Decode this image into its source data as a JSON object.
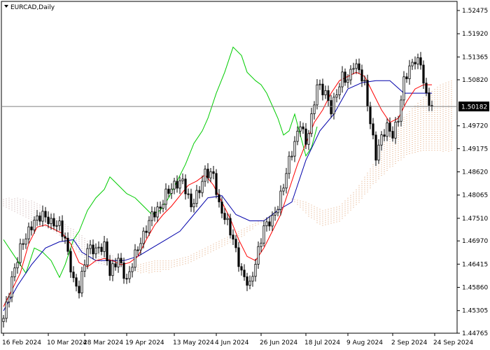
{
  "chart_data": {
    "type": "candlestick",
    "title": "EURCAD,Daily",
    "symbol": "EURCAD",
    "timeframe": "Daily",
    "current_price": 1.50182,
    "current_price_label": "1.50182",
    "y_range": [
      1.44765,
      1.52475
    ],
    "y_ticks": [
      "1.52475",
      "1.51920",
      "1.51365",
      "1.50820",
      "1.50182",
      "1.49720",
      "1.49175",
      "1.48620",
      "1.48065",
      "1.47510",
      "1.46970",
      "1.46415",
      "1.45860",
      "1.45305",
      "1.44765"
    ],
    "x_tick_labels": [
      "16 Feb 2024",
      "10 Mar 2024",
      "28 Mar 2024",
      "19 Apr 2024",
      "13 May 2024",
      "4 Jun 2024",
      "26 Jun 2024",
      "18 Jul 2024",
      "9 Aug 2024",
      "2 Sep 2024",
      "24 Sep 2024"
    ],
    "x_tick_index": [
      0,
      16,
      29,
      44,
      61,
      76,
      92,
      108,
      123,
      139,
      154
    ],
    "grid": false,
    "colors": {
      "candle": "#000000",
      "tenkan": "#ff0000",
      "kijun": "#0000aa",
      "chikou": "#00cc00",
      "kumo_bull": "#e0a070",
      "kumo_bear": "#c0a0a0",
      "price_line": "#808080"
    },
    "series": [
      {
        "id": "close",
        "anchors": [
          [
            0,
            1.4512
          ],
          [
            3,
            1.4605
          ],
          [
            6,
            1.468
          ],
          [
            9,
            1.472
          ],
          [
            11,
            1.4745
          ],
          [
            14,
            1.476
          ],
          [
            17,
            1.474
          ],
          [
            20,
            1.4735
          ],
          [
            22,
            1.47
          ],
          [
            25,
            1.46
          ],
          [
            27,
            1.458
          ],
          [
            30,
            1.468
          ],
          [
            33,
            1.4675
          ],
          [
            36,
            1.4685
          ],
          [
            38,
            1.462
          ],
          [
            41,
            1.4655
          ],
          [
            44,
            1.46
          ],
          [
            47,
            1.4665
          ],
          [
            50,
            1.471
          ],
          [
            53,
            1.476
          ],
          [
            56,
            1.4775
          ],
          [
            58,
            1.481
          ],
          [
            61,
            1.483
          ],
          [
            64,
            1.484
          ],
          [
            67,
            1.478
          ],
          [
            70,
            1.482
          ],
          [
            72,
            1.486
          ],
          [
            75,
            1.4855
          ],
          [
            77,
            1.478
          ],
          [
            80,
            1.474
          ],
          [
            82,
            1.47
          ],
          [
            85,
            1.462
          ],
          [
            88,
            1.459
          ],
          [
            90,
            1.4645
          ],
          [
            93,
            1.473
          ],
          [
            96,
            1.475
          ],
          [
            98,
            1.478
          ],
          [
            100,
            1.483
          ],
          [
            102,
            1.489
          ],
          [
            104,
            1.493
          ],
          [
            106,
            1.498
          ],
          [
            108,
            1.493
          ],
          [
            110,
            1.499
          ],
          [
            112,
            1.507
          ],
          [
            115,
            1.505
          ],
          [
            117,
            1.501
          ],
          [
            119,
            1.505
          ],
          [
            121,
            1.509
          ],
          [
            123,
            1.508
          ],
          [
            125,
            1.512
          ],
          [
            127,
            1.5105
          ],
          [
            129,
            1.507
          ],
          [
            131,
            1.498
          ],
          [
            133,
            1.49
          ],
          [
            135,
            1.4945
          ],
          [
            137,
            1.497
          ],
          [
            139,
            1.495
          ],
          [
            141,
            1.499
          ],
          [
            143,
            1.508
          ],
          [
            145,
            1.511
          ],
          [
            147,
            1.513
          ],
          [
            149,
            1.512
          ],
          [
            151,
            1.504
          ],
          [
            153,
            1.5018
          ]
        ]
      },
      {
        "id": "tenkan",
        "anchors": [
          [
            0,
            1.454
          ],
          [
            3,
            1.458
          ],
          [
            6,
            1.462
          ],
          [
            9,
            1.469
          ],
          [
            12,
            1.473
          ],
          [
            15,
            1.4735
          ],
          [
            18,
            1.4725
          ],
          [
            21,
            1.4715
          ],
          [
            24,
            1.469
          ],
          [
            27,
            1.4645
          ],
          [
            30,
            1.4635
          ],
          [
            33,
            1.465
          ],
          [
            36,
            1.4655
          ],
          [
            39,
            1.465
          ],
          [
            42,
            1.464
          ],
          [
            45,
            1.4645
          ],
          [
            48,
            1.466
          ],
          [
            51,
            1.47
          ],
          [
            54,
            1.4735
          ],
          [
            57,
            1.476
          ],
          [
            60,
            1.478
          ],
          [
            63,
            1.4805
          ],
          [
            66,
            1.483
          ],
          [
            69,
            1.484
          ],
          [
            72,
            1.4855
          ],
          [
            75,
            1.483
          ],
          [
            78,
            1.479
          ],
          [
            81,
            1.475
          ],
          [
            84,
            1.47
          ],
          [
            87,
            1.466
          ],
          [
            90,
            1.465
          ],
          [
            93,
            1.468
          ],
          [
            96,
            1.472
          ],
          [
            99,
            1.476
          ],
          [
            102,
            1.482
          ],
          [
            105,
            1.488
          ],
          [
            108,
            1.493
          ],
          [
            111,
            1.498
          ],
          [
            114,
            1.501
          ],
          [
            117,
            1.505
          ],
          [
            120,
            1.508
          ],
          [
            123,
            1.509
          ],
          [
            126,
            1.51
          ],
          [
            129,
            1.509
          ],
          [
            132,
            1.505
          ],
          [
            135,
            1.501
          ],
          [
            138,
            1.498
          ],
          [
            141,
            1.499
          ],
          [
            144,
            1.503
          ],
          [
            147,
            1.506
          ],
          [
            150,
            1.507
          ],
          [
            153,
            1.507
          ]
        ]
      },
      {
        "id": "kijun",
        "anchors": [
          [
            0,
            1.453
          ],
          [
            5,
            1.459
          ],
          [
            10,
            1.464
          ],
          [
            15,
            1.468
          ],
          [
            20,
            1.4695
          ],
          [
            25,
            1.47
          ],
          [
            28,
            1.467
          ],
          [
            33,
            1.465
          ],
          [
            38,
            1.465
          ],
          [
            43,
            1.465
          ],
          [
            48,
            1.466
          ],
          [
            53,
            1.468
          ],
          [
            58,
            1.47
          ],
          [
            63,
            1.472
          ],
          [
            68,
            1.476
          ],
          [
            73,
            1.48
          ],
          [
            78,
            1.4805
          ],
          [
            83,
            1.476
          ],
          [
            88,
            1.4745
          ],
          [
            93,
            1.4745
          ],
          [
            98,
            1.477
          ],
          [
            103,
            1.479
          ],
          [
            108,
            1.489
          ],
          [
            113,
            1.496
          ],
          [
            118,
            1.5
          ],
          [
            123,
            1.506
          ],
          [
            128,
            1.5075
          ],
          [
            133,
            1.508
          ],
          [
            138,
            1.508
          ],
          [
            143,
            1.505
          ],
          [
            148,
            1.505
          ],
          [
            153,
            1.505
          ]
        ]
      },
      {
        "id": "chikou",
        "anchors": [
          [
            0,
            1.47
          ],
          [
            4,
            1.466
          ],
          [
            8,
            1.462
          ],
          [
            11,
            1.468
          ],
          [
            14,
            1.467
          ],
          [
            17,
            1.465
          ],
          [
            20,
            1.461
          ],
          [
            22,
            1.464
          ],
          [
            25,
            1.47
          ],
          [
            27,
            1.472
          ],
          [
            30,
            1.477
          ],
          [
            33,
            1.48
          ],
          [
            36,
            1.482
          ],
          [
            38,
            1.485
          ],
          [
            41,
            1.483
          ],
          [
            44,
            1.481
          ],
          [
            47,
            1.48
          ],
          [
            50,
            1.478
          ],
          [
            53,
            1.476
          ],
          [
            56,
            1.477
          ],
          [
            59,
            1.48
          ],
          [
            62,
            1.484
          ],
          [
            65,
            1.488
          ],
          [
            68,
            1.493
          ],
          [
            71,
            1.496
          ],
          [
            73,
            1.499
          ],
          [
            76,
            1.505
          ],
          [
            79,
            1.51
          ],
          [
            82,
            1.516
          ],
          [
            85,
            1.514
          ],
          [
            87,
            1.51
          ],
          [
            90,
            1.508
          ],
          [
            92,
            1.507
          ],
          [
            94,
            1.505
          ],
          [
            96,
            1.502
          ],
          [
            98,
            1.499
          ],
          [
            100,
            1.495
          ],
          [
            102,
            1.496
          ],
          [
            104,
            1.5
          ],
          [
            106,
            1.495
          ],
          [
            108,
            1.49
          ],
          [
            110,
            1.492
          ],
          [
            112,
            1.497
          ]
        ]
      },
      {
        "id": "span_a",
        "anchors": [
          [
            0,
            1.478
          ],
          [
            6,
            1.476
          ],
          [
            12,
            1.474
          ],
          [
            18,
            1.472
          ],
          [
            24,
            1.469
          ],
          [
            30,
            1.465
          ],
          [
            36,
            1.464
          ],
          [
            42,
            1.464
          ],
          [
            48,
            1.464
          ],
          [
            54,
            1.465
          ],
          [
            60,
            1.465
          ],
          [
            66,
            1.466
          ],
          [
            72,
            1.468
          ],
          [
            78,
            1.47
          ],
          [
            84,
            1.472
          ],
          [
            90,
            1.474
          ],
          [
            96,
            1.476
          ],
          [
            102,
            1.48
          ],
          [
            108,
            1.479
          ],
          [
            114,
            1.477
          ],
          [
            120,
            1.478
          ],
          [
            126,
            1.482
          ],
          [
            132,
            1.488
          ],
          [
            138,
            1.496
          ],
          [
            144,
            1.5
          ],
          [
            150,
            1.504
          ],
          [
            156,
            1.507
          ],
          [
            160,
            1.508
          ]
        ]
      },
      {
        "id": "span_b",
        "anchors": [
          [
            0,
            1.48
          ],
          [
            6,
            1.48
          ],
          [
            12,
            1.479
          ],
          [
            18,
            1.476
          ],
          [
            24,
            1.473
          ],
          [
            30,
            1.47
          ],
          [
            36,
            1.468
          ],
          [
            42,
            1.465
          ],
          [
            48,
            1.462
          ],
          [
            54,
            1.462
          ],
          [
            60,
            1.463
          ],
          [
            66,
            1.464
          ],
          [
            72,
            1.466
          ],
          [
            78,
            1.468
          ],
          [
            84,
            1.47
          ],
          [
            90,
            1.473
          ],
          [
            96,
            1.476
          ],
          [
            102,
            1.48
          ],
          [
            108,
            1.476
          ],
          [
            114,
            1.473
          ],
          [
            120,
            1.474
          ],
          [
            126,
            1.478
          ],
          [
            132,
            1.483
          ],
          [
            138,
            1.487
          ],
          [
            144,
            1.49
          ],
          [
            150,
            1.491
          ],
          [
            156,
            1.491
          ],
          [
            160,
            1.491
          ]
        ]
      }
    ]
  }
}
